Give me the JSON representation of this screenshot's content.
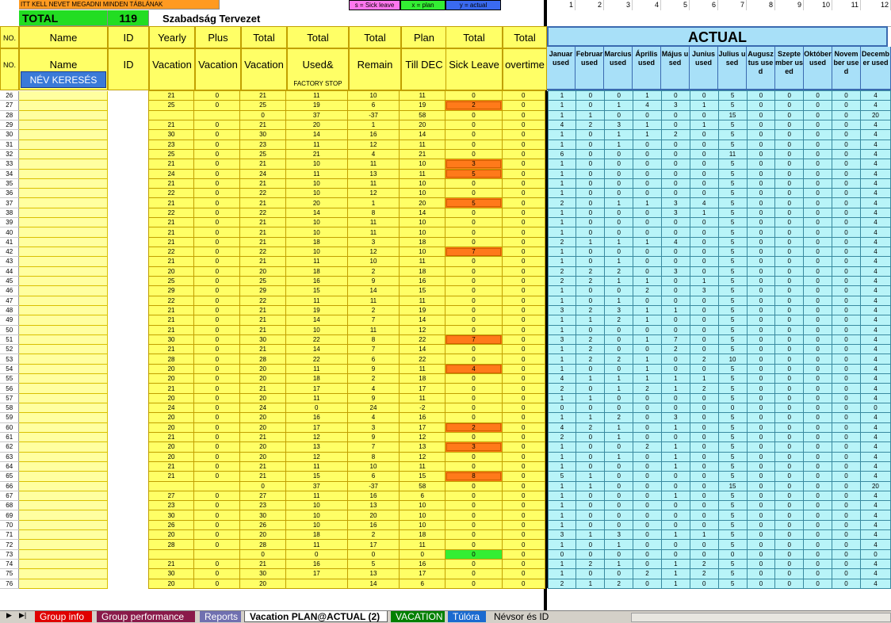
{
  "banner": {
    "warning": "ITT KELL NEVET MEGADNI MINDEN TÁBLÁNAK",
    "total_label": "TOTAL",
    "total_value": "119",
    "title": "Szabadság Tervezet"
  },
  "legend": {
    "s": "s = Sick leave",
    "x": "x = plan",
    "y": "y = actual"
  },
  "col_numbers": [
    "1",
    "2",
    "3",
    "4",
    "5",
    "6",
    "7",
    "8",
    "9",
    "10",
    "11",
    "12"
  ],
  "header_top": [
    "NO.",
    "Name",
    "ID",
    "Yearly",
    "Plus",
    "Total",
    "Total",
    "Total",
    "Plan",
    "Total",
    "Total"
  ],
  "header_bottom": [
    "NO.",
    "Name",
    "ID",
    "Vacation",
    "Vacation",
    "Vacation",
    "Used&",
    "Remain",
    "Till DEC",
    "Sick Leave",
    "overtime"
  ],
  "factory_stop": "FACTORY STOP",
  "search_button": "NÉV KERESÉS",
  "actual_title": "ACTUAL",
  "months": [
    "Januar used",
    "Februar used",
    "Marcius used",
    "Április used",
    "Május used",
    "Junius used",
    "Julius used",
    "Augusztus used",
    "Szeptember used",
    "Október used",
    "November used",
    "December used"
  ],
  "rows": [
    {
      "no": 26,
      "v": [
        "21",
        "0",
        "21",
        "11",
        "10",
        "11",
        "0",
        "0"
      ],
      "m": [
        "1",
        "0",
        "0",
        "1",
        "0",
        "0",
        "5",
        "0",
        "0",
        "0",
        "0",
        "4"
      ]
    },
    {
      "no": 27,
      "v": [
        "25",
        "0",
        "25",
        "19",
        "6",
        "19",
        "2",
        "0"
      ],
      "m": [
        "1",
        "0",
        "1",
        "4",
        "3",
        "1",
        "5",
        "0",
        "0",
        "0",
        "0",
        "4"
      ],
      "hot": 1
    },
    {
      "no": 28,
      "v": [
        "",
        "",
        "0",
        "37",
        "-37",
        "58",
        "0",
        "0"
      ],
      "m": [
        "1",
        "1",
        "0",
        "0",
        "0",
        "0",
        "15",
        "0",
        "0",
        "0",
        "0",
        "20"
      ]
    },
    {
      "no": 29,
      "v": [
        "21",
        "0",
        "21",
        "20",
        "1",
        "20",
        "0",
        "0"
      ],
      "m": [
        "4",
        "2",
        "3",
        "1",
        "0",
        "1",
        "5",
        "0",
        "0",
        "0",
        "0",
        "4"
      ]
    },
    {
      "no": 30,
      "v": [
        "30",
        "0",
        "30",
        "14",
        "16",
        "14",
        "0",
        "0"
      ],
      "m": [
        "1",
        "0",
        "1",
        "1",
        "2",
        "0",
        "5",
        "0",
        "0",
        "0",
        "0",
        "4"
      ]
    },
    {
      "no": 31,
      "v": [
        "23",
        "0",
        "23",
        "11",
        "12",
        "11",
        "0",
        "0"
      ],
      "m": [
        "1",
        "0",
        "1",
        "0",
        "0",
        "0",
        "5",
        "0",
        "0",
        "0",
        "0",
        "4"
      ]
    },
    {
      "no": 32,
      "v": [
        "25",
        "0",
        "25",
        "21",
        "4",
        "21",
        "0",
        "0"
      ],
      "m": [
        "6",
        "0",
        "0",
        "0",
        "0",
        "0",
        "11",
        "0",
        "0",
        "0",
        "0",
        "4"
      ]
    },
    {
      "no": 33,
      "v": [
        "21",
        "0",
        "21",
        "10",
        "11",
        "10",
        "3",
        "0"
      ],
      "m": [
        "1",
        "0",
        "0",
        "0",
        "0",
        "0",
        "5",
        "0",
        "0",
        "0",
        "0",
        "4"
      ],
      "hot": 1
    },
    {
      "no": 34,
      "v": [
        "24",
        "0",
        "24",
        "11",
        "13",
        "11",
        "5",
        "0"
      ],
      "m": [
        "1",
        "0",
        "0",
        "0",
        "0",
        "0",
        "5",
        "0",
        "0",
        "0",
        "0",
        "4"
      ],
      "hot": 1
    },
    {
      "no": 35,
      "v": [
        "21",
        "0",
        "21",
        "10",
        "11",
        "10",
        "0",
        "0"
      ],
      "m": [
        "1",
        "0",
        "0",
        "0",
        "0",
        "0",
        "5",
        "0",
        "0",
        "0",
        "0",
        "4"
      ]
    },
    {
      "no": 36,
      "v": [
        "22",
        "0",
        "22",
        "10",
        "12",
        "10",
        "0",
        "0"
      ],
      "m": [
        "1",
        "0",
        "0",
        "0",
        "0",
        "0",
        "5",
        "0",
        "0",
        "0",
        "0",
        "4"
      ]
    },
    {
      "no": 37,
      "v": [
        "21",
        "0",
        "21",
        "20",
        "1",
        "20",
        "5",
        "0"
      ],
      "m": [
        "2",
        "0",
        "1",
        "1",
        "3",
        "4",
        "5",
        "0",
        "0",
        "0",
        "0",
        "4"
      ],
      "hot": 1
    },
    {
      "no": 38,
      "v": [
        "22",
        "0",
        "22",
        "14",
        "8",
        "14",
        "0",
        "0"
      ],
      "m": [
        "1",
        "0",
        "0",
        "0",
        "3",
        "1",
        "5",
        "0",
        "0",
        "0",
        "0",
        "4"
      ]
    },
    {
      "no": 39,
      "v": [
        "21",
        "0",
        "21",
        "10",
        "11",
        "10",
        "0",
        "0"
      ],
      "m": [
        "1",
        "0",
        "0",
        "0",
        "0",
        "0",
        "5",
        "0",
        "0",
        "0",
        "0",
        "4"
      ]
    },
    {
      "no": 40,
      "v": [
        "21",
        "0",
        "21",
        "10",
        "11",
        "10",
        "0",
        "0"
      ],
      "m": [
        "1",
        "0",
        "0",
        "0",
        "0",
        "0",
        "5",
        "0",
        "0",
        "0",
        "0",
        "4"
      ]
    },
    {
      "no": 41,
      "v": [
        "21",
        "0",
        "21",
        "18",
        "3",
        "18",
        "0",
        "0"
      ],
      "m": [
        "2",
        "1",
        "1",
        "1",
        "4",
        "0",
        "5",
        "0",
        "0",
        "0",
        "0",
        "4"
      ]
    },
    {
      "no": 42,
      "v": [
        "22",
        "0",
        "22",
        "10",
        "12",
        "10",
        "7",
        "0"
      ],
      "m": [
        "1",
        "0",
        "0",
        "0",
        "0",
        "0",
        "5",
        "0",
        "0",
        "0",
        "0",
        "4"
      ],
      "hot": 1
    },
    {
      "no": 43,
      "v": [
        "21",
        "0",
        "21",
        "11",
        "10",
        "11",
        "0",
        "0"
      ],
      "m": [
        "1",
        "0",
        "1",
        "0",
        "0",
        "0",
        "5",
        "0",
        "0",
        "0",
        "0",
        "4"
      ]
    },
    {
      "no": 44,
      "v": [
        "20",
        "0",
        "20",
        "18",
        "2",
        "18",
        "0",
        "0"
      ],
      "m": [
        "2",
        "2",
        "2",
        "0",
        "3",
        "0",
        "5",
        "0",
        "0",
        "0",
        "0",
        "4"
      ]
    },
    {
      "no": 45,
      "v": [
        "25",
        "0",
        "25",
        "16",
        "9",
        "16",
        "0",
        "0"
      ],
      "m": [
        "2",
        "2",
        "1",
        "1",
        "0",
        "1",
        "5",
        "0",
        "0",
        "0",
        "0",
        "4"
      ]
    },
    {
      "no": 46,
      "v": [
        "29",
        "0",
        "29",
        "15",
        "14",
        "15",
        "0",
        "0"
      ],
      "m": [
        "1",
        "0",
        "0",
        "2",
        "0",
        "3",
        "5",
        "0",
        "0",
        "0",
        "0",
        "4"
      ]
    },
    {
      "no": 47,
      "v": [
        "22",
        "0",
        "22",
        "11",
        "11",
        "11",
        "0",
        "0"
      ],
      "m": [
        "1",
        "0",
        "1",
        "0",
        "0",
        "0",
        "5",
        "0",
        "0",
        "0",
        "0",
        "4"
      ]
    },
    {
      "no": 48,
      "v": [
        "21",
        "0",
        "21",
        "19",
        "2",
        "19",
        "0",
        "0"
      ],
      "m": [
        "3",
        "2",
        "3",
        "1",
        "1",
        "0",
        "5",
        "0",
        "0",
        "0",
        "0",
        "4"
      ]
    },
    {
      "no": 49,
      "v": [
        "21",
        "0",
        "21",
        "14",
        "7",
        "14",
        "0",
        "0"
      ],
      "m": [
        "1",
        "1",
        "2",
        "1",
        "0",
        "0",
        "5",
        "0",
        "0",
        "0",
        "0",
        "4"
      ]
    },
    {
      "no": 50,
      "v": [
        "21",
        "0",
        "21",
        "10",
        "11",
        "12",
        "0",
        "0"
      ],
      "m": [
        "1",
        "0",
        "0",
        "0",
        "0",
        "0",
        "5",
        "0",
        "0",
        "0",
        "0",
        "4"
      ]
    },
    {
      "no": 51,
      "v": [
        "30",
        "0",
        "30",
        "22",
        "8",
        "22",
        "7",
        "0"
      ],
      "m": [
        "3",
        "2",
        "0",
        "1",
        "7",
        "0",
        "5",
        "0",
        "0",
        "0",
        "0",
        "4"
      ],
      "hot": 1
    },
    {
      "no": 52,
      "v": [
        "21",
        "0",
        "21",
        "14",
        "7",
        "14",
        "0",
        "0"
      ],
      "m": [
        "1",
        "2",
        "0",
        "0",
        "2",
        "0",
        "5",
        "0",
        "0",
        "0",
        "0",
        "4"
      ]
    },
    {
      "no": 53,
      "v": [
        "28",
        "0",
        "28",
        "22",
        "6",
        "22",
        "0",
        "0"
      ],
      "m": [
        "1",
        "2",
        "2",
        "1",
        "0",
        "2",
        "10",
        "0",
        "0",
        "0",
        "0",
        "4"
      ]
    },
    {
      "no": 54,
      "v": [
        "20",
        "0",
        "20",
        "11",
        "9",
        "11",
        "4",
        "0"
      ],
      "m": [
        "1",
        "0",
        "0",
        "1",
        "0",
        "0",
        "5",
        "0",
        "0",
        "0",
        "0",
        "4"
      ],
      "hot": 1
    },
    {
      "no": 55,
      "v": [
        "20",
        "0",
        "20",
        "18",
        "2",
        "18",
        "0",
        "0"
      ],
      "m": [
        "4",
        "1",
        "1",
        "1",
        "1",
        "1",
        "5",
        "0",
        "0",
        "0",
        "0",
        "4"
      ]
    },
    {
      "no": 56,
      "v": [
        "21",
        "0",
        "21",
        "17",
        "4",
        "17",
        "0",
        "0"
      ],
      "m": [
        "2",
        "0",
        "1",
        "2",
        "1",
        "2",
        "5",
        "0",
        "0",
        "0",
        "0",
        "4"
      ]
    },
    {
      "no": 57,
      "v": [
        "20",
        "0",
        "20",
        "11",
        "9",
        "11",
        "0",
        "0"
      ],
      "m": [
        "1",
        "1",
        "0",
        "0",
        "0",
        "0",
        "5",
        "0",
        "0",
        "0",
        "0",
        "4"
      ]
    },
    {
      "no": 58,
      "v": [
        "24",
        "0",
        "24",
        "0",
        "24",
        "-2",
        "0",
        "0"
      ],
      "m": [
        "0",
        "0",
        "0",
        "0",
        "0",
        "0",
        "0",
        "0",
        "0",
        "0",
        "0",
        "0"
      ]
    },
    {
      "no": 59,
      "v": [
        "20",
        "0",
        "20",
        "16",
        "4",
        "16",
        "0",
        "0"
      ],
      "m": [
        "1",
        "1",
        "2",
        "0",
        "3",
        "0",
        "5",
        "0",
        "0",
        "0",
        "0",
        "4"
      ]
    },
    {
      "no": 60,
      "v": [
        "20",
        "0",
        "20",
        "17",
        "3",
        "17",
        "2",
        "0"
      ],
      "m": [
        "4",
        "2",
        "1",
        "0",
        "1",
        "0",
        "5",
        "0",
        "0",
        "0",
        "0",
        "4"
      ],
      "hot": 1
    },
    {
      "no": 61,
      "v": [
        "21",
        "0",
        "21",
        "12",
        "9",
        "12",
        "0",
        "0"
      ],
      "m": [
        "2",
        "0",
        "1",
        "0",
        "0",
        "0",
        "5",
        "0",
        "0",
        "0",
        "0",
        "4"
      ]
    },
    {
      "no": 62,
      "v": [
        "20",
        "0",
        "20",
        "13",
        "7",
        "13",
        "3",
        "0"
      ],
      "m": [
        "1",
        "0",
        "0",
        "2",
        "1",
        "0",
        "5",
        "0",
        "0",
        "0",
        "0",
        "4"
      ],
      "hot": 1
    },
    {
      "no": 63,
      "v": [
        "20",
        "0",
        "20",
        "12",
        "8",
        "12",
        "0",
        "0"
      ],
      "m": [
        "1",
        "0",
        "1",
        "0",
        "1",
        "0",
        "5",
        "0",
        "0",
        "0",
        "0",
        "4"
      ]
    },
    {
      "no": 64,
      "v": [
        "21",
        "0",
        "21",
        "11",
        "10",
        "11",
        "0",
        "0"
      ],
      "m": [
        "1",
        "0",
        "0",
        "0",
        "1",
        "0",
        "5",
        "0",
        "0",
        "0",
        "0",
        "4"
      ]
    },
    {
      "no": 65,
      "v": [
        "21",
        "0",
        "21",
        "15",
        "6",
        "15",
        "8",
        "0"
      ],
      "m": [
        "5",
        "1",
        "0",
        "0",
        "0",
        "0",
        "5",
        "0",
        "0",
        "0",
        "0",
        "4"
      ],
      "hot": 1
    },
    {
      "no": 66,
      "v": [
        "",
        "",
        "0",
        "37",
        "-37",
        "58",
        "0",
        "0"
      ],
      "m": [
        "1",
        "1",
        "0",
        "0",
        "0",
        "0",
        "15",
        "0",
        "0",
        "0",
        "0",
        "20"
      ]
    },
    {
      "no": 67,
      "v": [
        "27",
        "0",
        "27",
        "11",
        "16",
        "6",
        "0",
        "0"
      ],
      "m": [
        "1",
        "0",
        "0",
        "0",
        "1",
        "0",
        "5",
        "0",
        "0",
        "0",
        "0",
        "4"
      ]
    },
    {
      "no": 68,
      "v": [
        "23",
        "0",
        "23",
        "10",
        "13",
        "10",
        "0",
        "0"
      ],
      "m": [
        "1",
        "0",
        "0",
        "0",
        "0",
        "0",
        "5",
        "0",
        "0",
        "0",
        "0",
        "4"
      ]
    },
    {
      "no": 69,
      "v": [
        "30",
        "0",
        "30",
        "10",
        "20",
        "10",
        "0",
        "0"
      ],
      "m": [
        "1",
        "0",
        "0",
        "0",
        "0",
        "0",
        "5",
        "0",
        "0",
        "0",
        "0",
        "4"
      ]
    },
    {
      "no": 70,
      "v": [
        "26",
        "0",
        "26",
        "10",
        "16",
        "10",
        "0",
        "0"
      ],
      "m": [
        "1",
        "0",
        "0",
        "0",
        "0",
        "0",
        "5",
        "0",
        "0",
        "0",
        "0",
        "4"
      ]
    },
    {
      "no": 71,
      "v": [
        "20",
        "0",
        "20",
        "18",
        "2",
        "18",
        "0",
        "0"
      ],
      "m": [
        "3",
        "1",
        "3",
        "0",
        "1",
        "1",
        "5",
        "0",
        "0",
        "0",
        "0",
        "4"
      ]
    },
    {
      "no": 72,
      "v": [
        "28",
        "0",
        "28",
        "11",
        "17",
        "11",
        "0",
        "0"
      ],
      "m": [
        "1",
        "0",
        "1",
        "0",
        "0",
        "0",
        "5",
        "0",
        "0",
        "0",
        "0",
        "4"
      ]
    },
    {
      "no": 73,
      "v": [
        "",
        "",
        "0",
        "0",
        "0",
        "0",
        "0",
        "0"
      ],
      "m": [
        "0",
        "0",
        "0",
        "0",
        "0",
        "0",
        "0",
        "0",
        "0",
        "0",
        "0",
        "0"
      ],
      "green": 1
    },
    {
      "no": 74,
      "v": [
        "21",
        "0",
        "21",
        "16",
        "5",
        "16",
        "0",
        "0"
      ],
      "m": [
        "1",
        "2",
        "1",
        "0",
        "1",
        "2",
        "5",
        "0",
        "0",
        "0",
        "0",
        "4"
      ]
    },
    {
      "no": 75,
      "v": [
        "30",
        "0",
        "30",
        "17",
        "13",
        "17",
        "0",
        "0"
      ],
      "m": [
        "1",
        "0",
        "0",
        "2",
        "1",
        "2",
        "5",
        "0",
        "0",
        "0",
        "0",
        "4"
      ]
    },
    {
      "no": 76,
      "v": [
        "20",
        "0",
        "20",
        "",
        "14",
        "6",
        "0",
        "0"
      ],
      "m": [
        "2",
        "1",
        "2",
        "0",
        "1",
        "0",
        "5",
        "0",
        "0",
        "0",
        "0",
        "4"
      ]
    }
  ],
  "tabs": [
    {
      "label": "Group info",
      "color": "#e00000"
    },
    {
      "label": "Group performance",
      "color": "#8a1a4a"
    },
    {
      "label": "Reports",
      "color": "#7070b0"
    },
    {
      "label": "Vacation PLAN@ACTUAL (2)",
      "color": "active"
    },
    {
      "label": "VACATION",
      "color": "#008000"
    },
    {
      "label": "Túlóra",
      "color": "#1a6ad0"
    },
    {
      "label": "Névsor és ID",
      "color": "plain"
    }
  ]
}
